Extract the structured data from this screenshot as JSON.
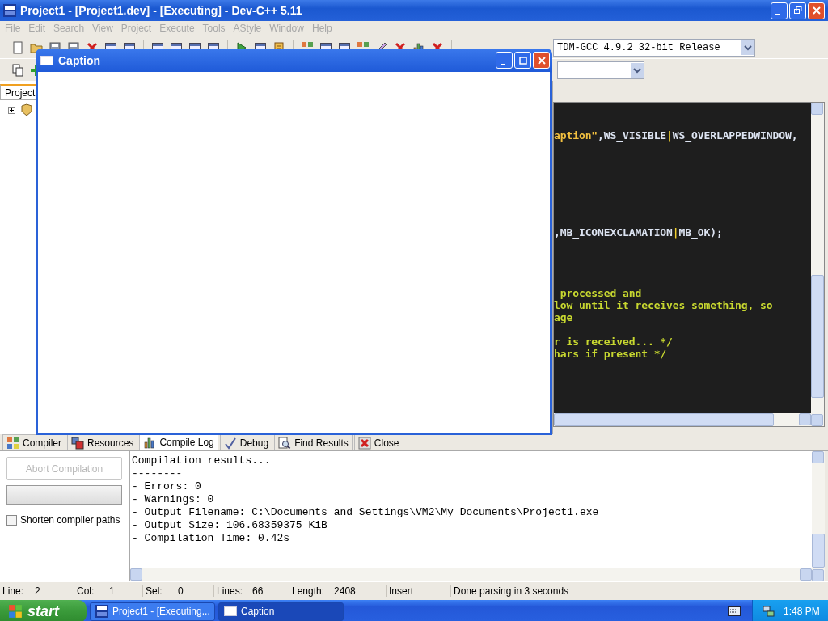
{
  "main_window": {
    "title": "Project1 - [Project1.dev] - [Executing] - Dev-C++ 5.11"
  },
  "menu": [
    "File",
    "Edit",
    "Search",
    "View",
    "Project",
    "Execute",
    "Tools",
    "AStyle",
    "Window",
    "Help"
  ],
  "toolbar": {
    "compiler_select": {
      "value": "TDM-GCC 4.9.2 32-bit Release"
    }
  },
  "project_panel": {
    "tabs": [
      {
        "label": "Project",
        "selected": true
      }
    ],
    "tree": [
      {
        "expanded": false
      }
    ]
  },
  "editor": {
    "lines": [
      {
        "kind": "blank"
      },
      {
        "kind": "blank"
      },
      {
        "kind": "code",
        "segments": [
          {
            "kind": "string",
            "text": "aption\""
          },
          {
            "kind": "plain",
            "text": ",WS_VISIBLE"
          },
          {
            "kind": "operator",
            "text": "|"
          },
          {
            "kind": "plain",
            "text": "WS_OVERLAPPEDWINDOW,"
          }
        ]
      },
      {
        "kind": "blank"
      },
      {
        "kind": "blank"
      },
      {
        "kind": "blank"
      },
      {
        "kind": "blank"
      },
      {
        "kind": "blank"
      },
      {
        "kind": "blank"
      },
      {
        "kind": "blank"
      },
      {
        "kind": "code",
        "segments": [
          {
            "kind": "plain",
            "text": ",MB_ICONEXCLAMATION"
          },
          {
            "kind": "operator",
            "text": "|"
          },
          {
            "kind": "plain",
            "text": "MB_OK);"
          }
        ]
      },
      {
        "kind": "blank"
      },
      {
        "kind": "blank"
      },
      {
        "kind": "blank"
      },
      {
        "kind": "blank"
      },
      {
        "kind": "code",
        "segments": [
          {
            "kind": "comment",
            "text": " processed and"
          }
        ]
      },
      {
        "kind": "code",
        "segments": [
          {
            "kind": "comment",
            "text": "low until it receives something, so"
          }
        ]
      },
      {
        "kind": "code",
        "segments": [
          {
            "kind": "comment",
            "text": "age"
          }
        ]
      },
      {
        "kind": "blank"
      },
      {
        "kind": "code",
        "segments": [
          {
            "kind": "comment",
            "text": "r is received... */"
          }
        ]
      },
      {
        "kind": "code",
        "segments": [
          {
            "kind": "comment",
            "text": "hars if present */"
          }
        ]
      }
    ]
  },
  "popup_window": {
    "title": "Caption"
  },
  "bottom_tabs": [
    {
      "label": "Compiler",
      "selected": false
    },
    {
      "label": "Resources",
      "selected": false
    },
    {
      "label": "Compile Log",
      "selected": true
    },
    {
      "label": "Debug",
      "selected": false
    },
    {
      "label": "Find Results",
      "selected": false
    },
    {
      "label": "Close",
      "selected": false
    }
  ],
  "compiler_panel": {
    "abort_button": {
      "label": "Abort Compilation",
      "disabled": true
    },
    "progress": {
      "level": 0
    },
    "shorten_paths": {
      "label": "Shorten compiler paths",
      "checked": false
    }
  },
  "compile_log": {
    "lines": [
      "Compilation results...",
      "--------",
      "- Errors: 0",
      "- Warnings: 0",
      "- Output Filename: C:\\Documents and Settings\\VM2\\My Documents\\Project1.exe",
      "- Output Size: 106.68359375 KiB",
      "- Compilation Time: 0.42s"
    ]
  },
  "status_bar": {
    "fields": [
      {
        "label": "Line:",
        "value": "2"
      },
      {
        "label": "Col:",
        "value": "1"
      },
      {
        "label": "Sel:",
        "value": "0"
      },
      {
        "label": "Lines:",
        "value": "66"
      },
      {
        "label": "Length:",
        "value": "2408"
      },
      {
        "value": "Insert"
      },
      {
        "value": "Done parsing in 3 seconds"
      }
    ]
  },
  "taskbar": {
    "start": "start",
    "tasks": [
      {
        "label": "Project1 - [Executing...",
        "selected": false
      },
      {
        "label": "Caption",
        "selected": true
      }
    ],
    "clock": "1:48 PM"
  }
}
